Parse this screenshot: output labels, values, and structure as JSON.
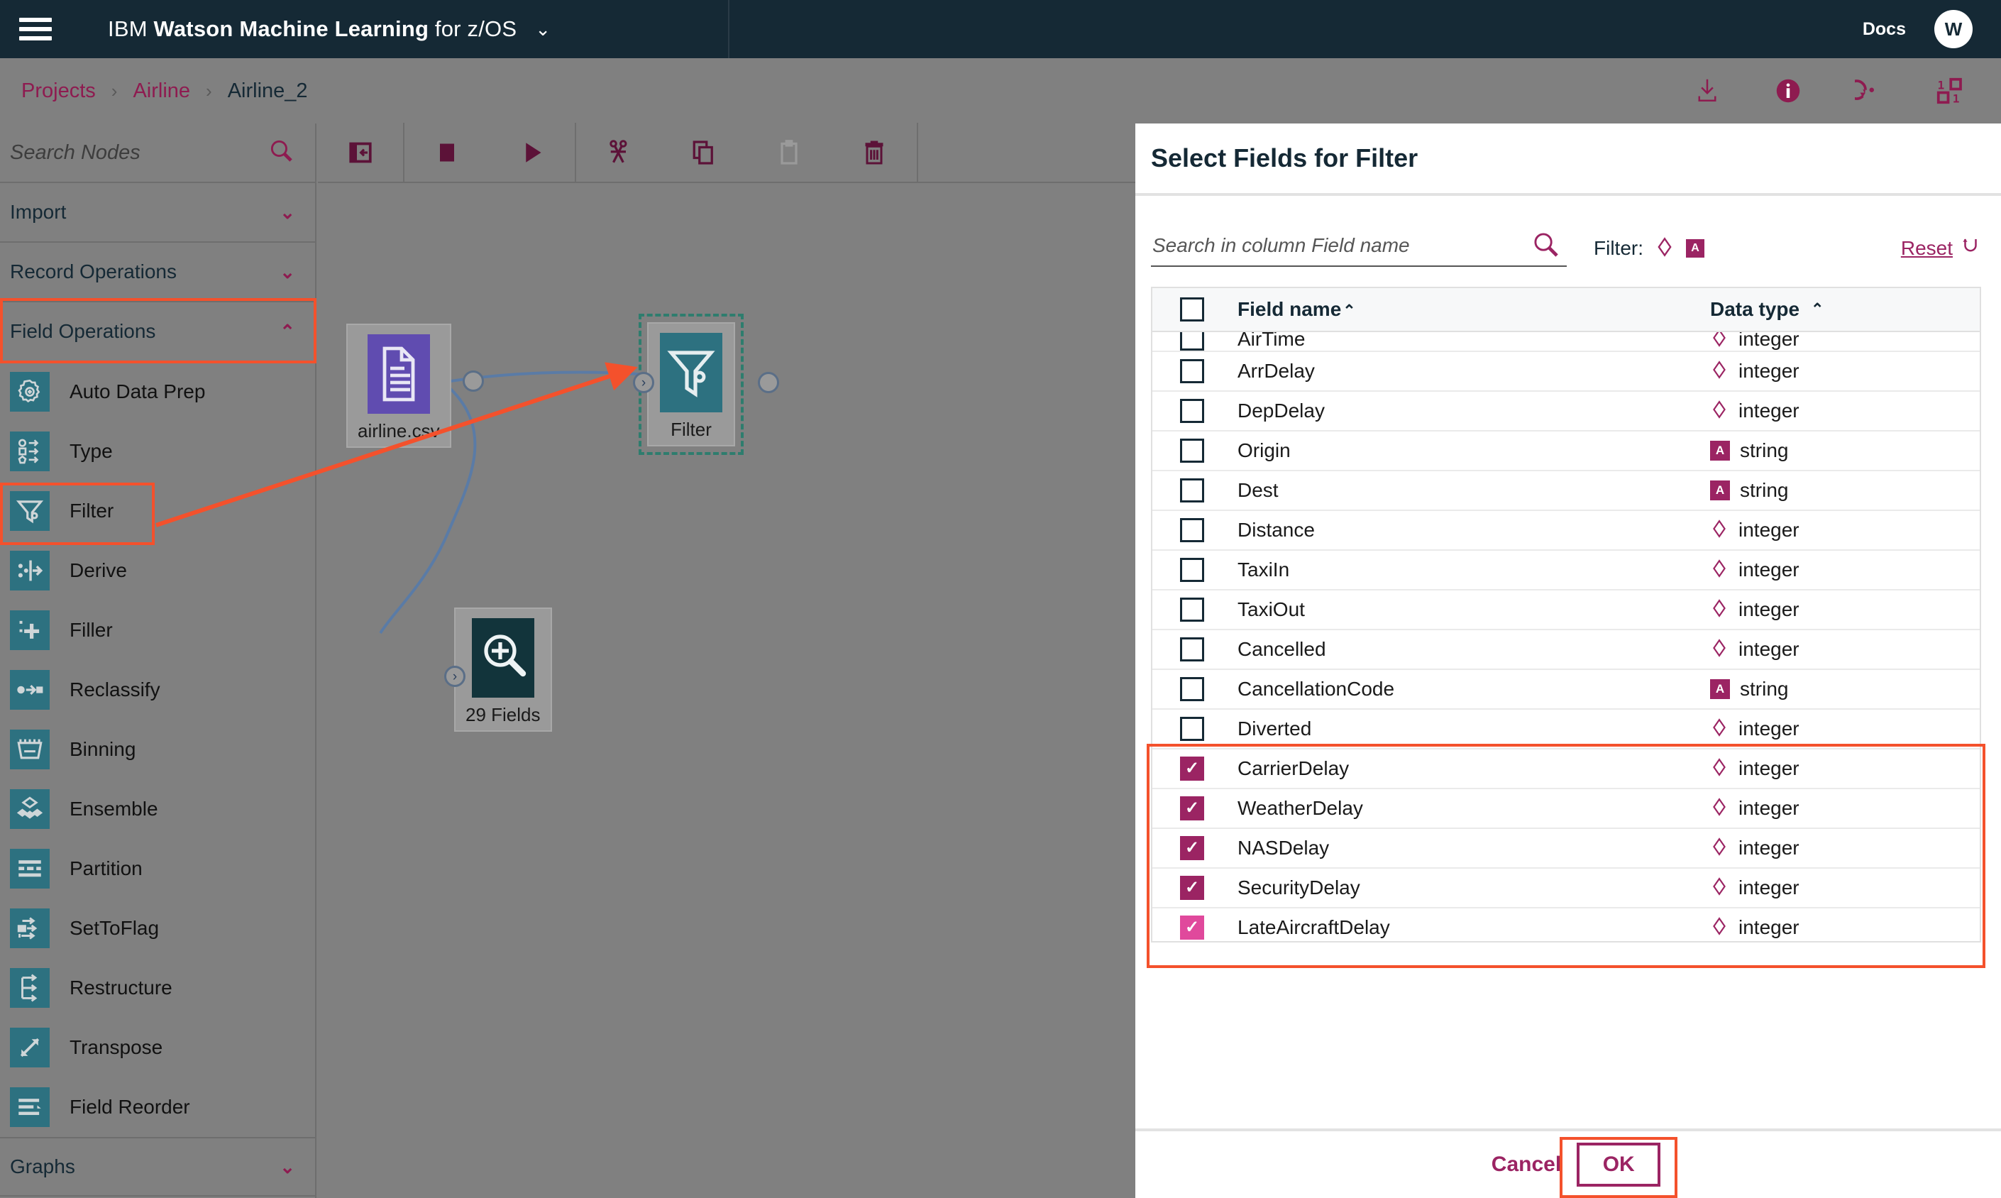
{
  "header": {
    "menu_icon": "hamburger-icon",
    "brand_prefix": "IBM",
    "brand_bold": "Watson Machine Learning",
    "brand_suffix": "for z/OS",
    "brand_chevron": "⌄",
    "docs_label": "Docs",
    "avatar_initial": "W"
  },
  "breadcrumb": {
    "items": [
      {
        "label": "Projects",
        "current": false
      },
      {
        "label": "Airline",
        "current": false
      },
      {
        "label": "Airline_2",
        "current": true
      }
    ],
    "separator": "›",
    "actions": [
      {
        "name": "download-icon"
      },
      {
        "name": "info-icon"
      },
      {
        "name": "undo-history-icon"
      },
      {
        "name": "binary-grid-icon"
      }
    ]
  },
  "palette": {
    "search_placeholder": "Search Nodes",
    "search_value": "",
    "search_icon": "search-icon",
    "sections": [
      {
        "label": "Import",
        "expanded": false,
        "chevron": "⌄"
      },
      {
        "label": "Record Operations",
        "expanded": false,
        "chevron": "⌄"
      },
      {
        "label": "Field Operations",
        "expanded": true,
        "chevron": "⌃"
      }
    ],
    "field_operations_items": [
      {
        "label": "Auto Data Prep",
        "icon": "gear-plus-icon"
      },
      {
        "label": "Type",
        "icon": "type-shapes-icon"
      },
      {
        "label": "Filter",
        "icon": "funnel-icon"
      },
      {
        "label": "Derive",
        "icon": "derive-icon"
      },
      {
        "label": "Filler",
        "icon": "filler-plus-icon"
      },
      {
        "label": "Reclassify",
        "icon": "reclassify-icon"
      },
      {
        "label": "Binning",
        "icon": "binning-icon"
      },
      {
        "label": "Ensemble",
        "icon": "ensemble-icon"
      },
      {
        "label": "Partition",
        "icon": "partition-icon"
      },
      {
        "label": "SetToFlag",
        "icon": "settoflag-icon"
      },
      {
        "label": "Restructure",
        "icon": "restructure-icon"
      },
      {
        "label": "Transpose",
        "icon": "transpose-icon"
      },
      {
        "label": "Field Reorder",
        "icon": "field-reorder-icon"
      }
    ],
    "bottom_section": {
      "label": "Graphs",
      "chevron": "⌄"
    }
  },
  "canvas_toolbar": {
    "buttons": [
      {
        "name": "toggle-palette-button",
        "icon": "panel-collapse-icon"
      },
      {
        "name": "stop-button",
        "icon": "stop-square-icon"
      },
      {
        "name": "run-button",
        "icon": "play-triangle-icon"
      },
      {
        "name": "cut-button",
        "icon": "scissors-icon"
      },
      {
        "name": "copy-button",
        "icon": "copy-icon"
      },
      {
        "name": "paste-button",
        "icon": "paste-icon"
      },
      {
        "name": "delete-button",
        "icon": "trash-icon"
      }
    ]
  },
  "canvas": {
    "nodes": [
      {
        "id": "source",
        "label": "airline.csv",
        "icon": "csv-document-icon",
        "color": "#604cb0",
        "selected": false
      },
      {
        "id": "filter",
        "label": "Filter",
        "icon": "funnel-icon",
        "color": "#2d7180",
        "selected": true
      },
      {
        "id": "fields",
        "label": "29 Fields",
        "icon": "magnifier-plus-icon",
        "color": "#12343b",
        "selected": false
      }
    ]
  },
  "modal": {
    "title": "Select Fields for Filter",
    "search_placeholder": "Search in column Field name",
    "search_value": "",
    "search_icon": "search-icon",
    "filter_label": "Filter:",
    "filter_types": [
      {
        "name": "integer-type-toggle",
        "glyph": "◇"
      },
      {
        "name": "string-type-toggle",
        "glyph": "A"
      }
    ],
    "reset_label": "Reset",
    "reset_icon": "reset-arrow-icon",
    "columns": {
      "field_name": "Field name",
      "data_type": "Data type",
      "sort_caret": "⌃"
    },
    "rows": [
      {
        "name": "AirTime",
        "type": "integer",
        "type_kind": "integer",
        "checked": false,
        "partial": true
      },
      {
        "name": "ArrDelay",
        "type": "integer",
        "type_kind": "integer",
        "checked": false
      },
      {
        "name": "DepDelay",
        "type": "integer",
        "type_kind": "integer",
        "checked": false
      },
      {
        "name": "Origin",
        "type": "string",
        "type_kind": "string",
        "checked": false
      },
      {
        "name": "Dest",
        "type": "string",
        "type_kind": "string",
        "checked": false
      },
      {
        "name": "Distance",
        "type": "integer",
        "type_kind": "integer",
        "checked": false
      },
      {
        "name": "TaxiIn",
        "type": "integer",
        "type_kind": "integer",
        "checked": false
      },
      {
        "name": "TaxiOut",
        "type": "integer",
        "type_kind": "integer",
        "checked": false
      },
      {
        "name": "Cancelled",
        "type": "integer",
        "type_kind": "integer",
        "checked": false
      },
      {
        "name": "CancellationCode",
        "type": "string",
        "type_kind": "string",
        "checked": false
      },
      {
        "name": "Diverted",
        "type": "integer",
        "type_kind": "integer",
        "checked": false
      },
      {
        "name": "CarrierDelay",
        "type": "integer",
        "type_kind": "integer",
        "checked": true
      },
      {
        "name": "WeatherDelay",
        "type": "integer",
        "type_kind": "integer",
        "checked": true
      },
      {
        "name": "NASDelay",
        "type": "integer",
        "type_kind": "integer",
        "checked": true
      },
      {
        "name": "SecurityDelay",
        "type": "integer",
        "type_kind": "integer",
        "checked": true
      },
      {
        "name": "LateAircraftDelay",
        "type": "integer",
        "type_kind": "integer",
        "checked": true,
        "highlight_last": true
      }
    ],
    "footer": {
      "cancel_label": "Cancel",
      "ok_label": "OK"
    }
  },
  "colors": {
    "header_bg": "#152935",
    "accent_magenta": "#9b2463",
    "crumb_link": "#8e1b50",
    "annotation_red": "#f4512c",
    "node_teal": "#2d7180",
    "node_purple": "#604cb0",
    "node_dark": "#12343b",
    "canvas_bg": "#808080"
  }
}
